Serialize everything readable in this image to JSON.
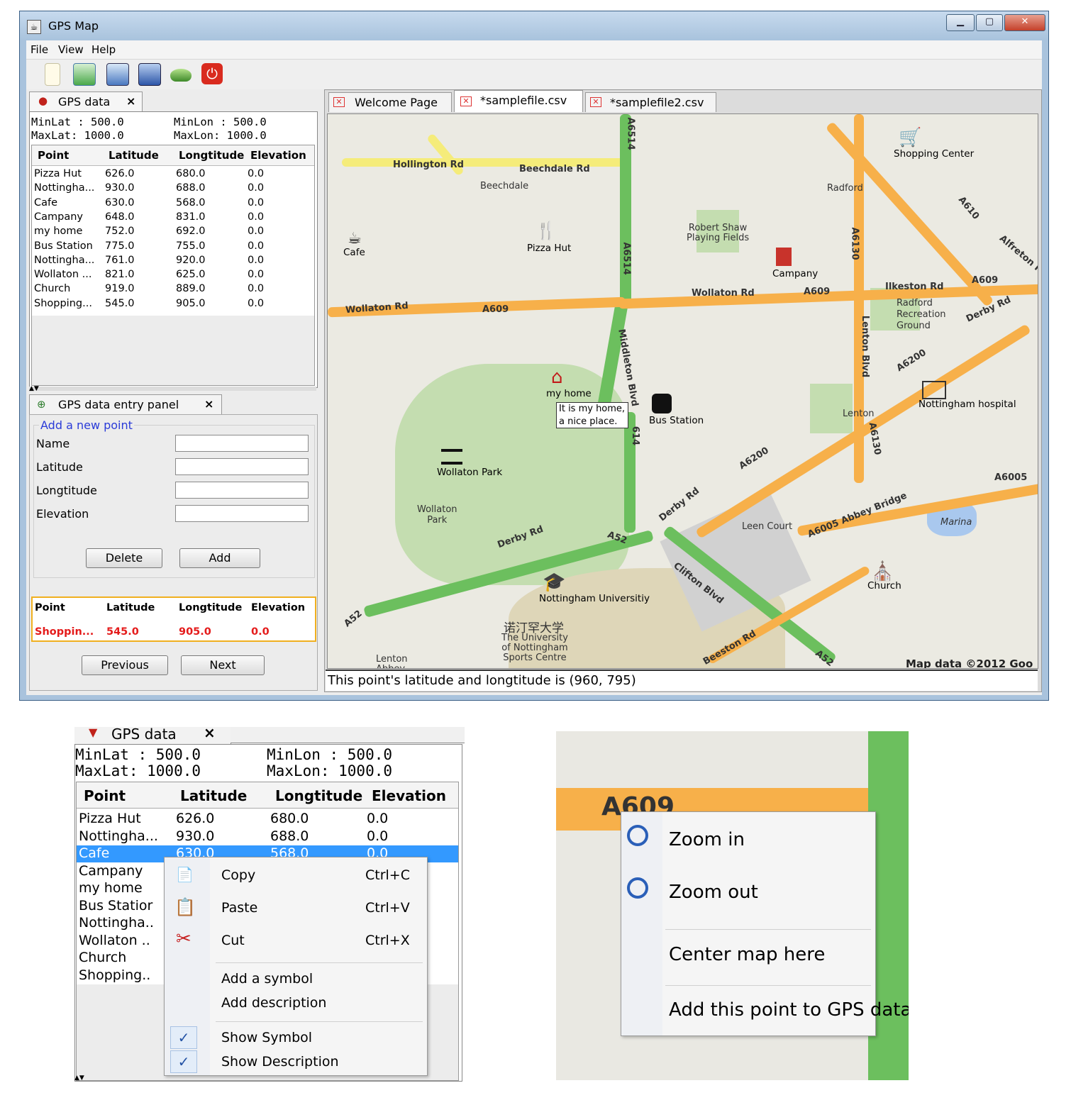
{
  "window": {
    "title": "GPS Map",
    "menu": [
      "File",
      "View",
      "Help"
    ],
    "toolbar_icons": [
      "new-file-icon",
      "open-file-icon",
      "edit-icon",
      "save-icon",
      "layers-icon",
      "power-icon"
    ]
  },
  "gps_panel": {
    "tab_label": "GPS data",
    "close": "×",
    "minlat": "MinLat : 500.0",
    "minlon": "MinLon : 500.0",
    "maxlat": "MaxLat: 1000.0",
    "maxlon": "MaxLon: 1000.0",
    "columns": [
      "Point",
      "Latitude",
      "Longtitude",
      "Elevation"
    ],
    "rows": [
      [
        "Pizza Hut",
        "626.0",
        "680.0",
        "0.0"
      ],
      [
        "Nottingha...",
        "930.0",
        "688.0",
        "0.0"
      ],
      [
        "Cafe",
        "630.0",
        "568.0",
        "0.0"
      ],
      [
        "Campany",
        "648.0",
        "831.0",
        "0.0"
      ],
      [
        "my home",
        "752.0",
        "692.0",
        "0.0"
      ],
      [
        "Bus Station",
        "775.0",
        "755.0",
        "0.0"
      ],
      [
        "Nottingha...",
        "761.0",
        "920.0",
        "0.0"
      ],
      [
        "Wollaton ...",
        "821.0",
        "625.0",
        "0.0"
      ],
      [
        "Church",
        "919.0",
        "889.0",
        "0.0"
      ],
      [
        "Shopping...",
        "545.0",
        "905.0",
        "0.0"
      ]
    ]
  },
  "entry_panel": {
    "tab_label": "GPS data entry panel",
    "close": "×",
    "group_title": "Add a new point",
    "fields": [
      "Name",
      "Latitude",
      "Longtitude",
      "Elevation"
    ],
    "delete_label": "Delete",
    "add_label": "Add",
    "selected_columns": [
      "Point",
      "Latitude",
      "Longtitude",
      "Elevation"
    ],
    "selected_row": [
      "Shoppin...",
      "545.0",
      "905.0",
      "0.0"
    ],
    "previous_label": "Previous",
    "next_label": "Next"
  },
  "map_tabs": [
    "Welcome Page",
    "*samplefile.csv",
    "*samplefile2.csv"
  ],
  "map": {
    "roads": {
      "hollington": "Hollington Rd",
      "beechdale_rd": "Beechdale Rd",
      "beechdale": "Beechdale",
      "a6514_top": "A6514",
      "a6514_mid": "A6514",
      "radford": "Radford",
      "a610": "A610",
      "alfreton": "Alfreton R",
      "a6130_top": "A6130",
      "wollaton_left": "Wollaton Rd",
      "a609_left": "A609",
      "wollaton_right": "Wollaton Rd",
      "a609_mid": "A609",
      "ilkeston": "Ilkeston Rd",
      "a609_right": "A609",
      "derby_right": "Derby Rd",
      "radford_rec": "Radford\nRecreation\nGround",
      "lenton_blvd": "Lenton Blvd",
      "a6200_top": "A6200",
      "middleton": "Middleton Blvd",
      "a614_partial": "614",
      "lenton": "Lenton",
      "a6130_bottom": "A6130",
      "a6200_mid": "A6200",
      "a6005": "A6005",
      "derby_mid": "Derby Rd",
      "abbey": "A6005 Abbey Bridge",
      "marina": "Marina",
      "leen": "Leen Court",
      "derby_low": "Derby Rd",
      "a52_mid": "A52",
      "clifton": "Clifton Blvd",
      "a52_left": "A52",
      "beeston": "Beeston Rd",
      "a52_bottom": "A52",
      "robert_shaw": "Robert Shaw\nPlaying Fields",
      "wollaton_park_small": "Wollaton\nPark",
      "univ_cn": "诺汀罕大学",
      "univ_en": "The University\nof Nottingham\nSports Centre",
      "lenton_abbey": "Lenton\nAbbey"
    },
    "pois": {
      "cafe": "Cafe",
      "pizza": "Pizza Hut",
      "shopping": "Shopping Center",
      "campany": "Campany",
      "myhome": "my home",
      "bus": "Bus Station",
      "hospital": "Nottingham hospital",
      "park": "Wollaton Park",
      "univ": "Nottingham Universitiy",
      "church": "Church"
    },
    "tooltip": "It is my home,\na nice place.",
    "attribution": "Map data ©2012 Goo",
    "status": "This point's latitude and longtitude is (960, 795)"
  },
  "zoom_panel": {
    "tab_label": "GPS data",
    "close": "×",
    "minlat": "MinLat : 500.0",
    "minlon": "MinLon : 500.0",
    "maxlat": "MaxLat: 1000.0",
    "maxlon": "MaxLon: 1000.0",
    "columns": [
      "Point",
      "Latitude",
      "Longtitude",
      "Elevation"
    ],
    "rows": [
      [
        "Pizza Hut",
        "626.0",
        "680.0",
        "0.0"
      ],
      [
        "Nottingha...",
        "930.0",
        "688.0",
        "0.0"
      ],
      [
        "Cafe",
        "630.0",
        "568.0",
        "0.0"
      ],
      [
        "Campany",
        "",
        "",
        ""
      ],
      [
        "my home",
        "",
        "",
        ""
      ],
      [
        "Bus Statior",
        "",
        "",
        ""
      ],
      [
        "Nottingha..",
        "",
        "",
        ""
      ],
      [
        "Wollaton ..",
        "",
        "",
        ""
      ],
      [
        "Church",
        "",
        "",
        ""
      ],
      [
        "Shopping..",
        "",
        "",
        ""
      ]
    ],
    "context_menu": {
      "copy": "Copy",
      "copy_key": "Ctrl+C",
      "paste": "Paste",
      "paste_key": "Ctrl+V",
      "cut": "Cut",
      "cut_key": "Ctrl+X",
      "add_symbol": "Add a symbol",
      "add_desc": "Add description",
      "show_symbol": "Show Symbol",
      "show_desc": "Show Description"
    }
  },
  "map_context_menu": {
    "zoom_in": "Zoom in",
    "zoom_out": "Zoom out",
    "center": "Center map here",
    "add_point": "Add this point to GPS data",
    "road_label": "A609"
  }
}
